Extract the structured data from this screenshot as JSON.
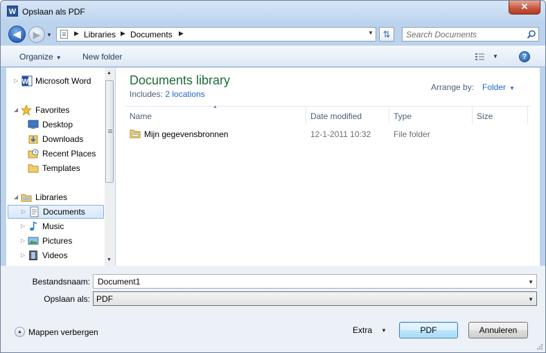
{
  "window": {
    "title": "Opslaan als PDF",
    "app_icon_letter": "W",
    "close_glyph": "✕"
  },
  "address_bar": {
    "breadcrumbs": [
      "Libraries",
      "Documents"
    ],
    "search_placeholder": "Search Documents"
  },
  "toolbar": {
    "organize_label": "Organize",
    "new_folder_label": "New folder",
    "help_glyph": "?"
  },
  "nav_pane": {
    "items": [
      {
        "label": "Microsoft Word",
        "icon": "word-icon",
        "indent": 0,
        "expander": "collapsed"
      },
      {
        "label": "Favorites",
        "icon": "star-icon",
        "indent": 0,
        "expander": "expanded"
      },
      {
        "label": "Desktop",
        "icon": "desktop-icon",
        "indent": 1,
        "expander": "none"
      },
      {
        "label": "Downloads",
        "icon": "downloads-icon",
        "indent": 1,
        "expander": "none"
      },
      {
        "label": "Recent Places",
        "icon": "recent-places-icon",
        "indent": 1,
        "expander": "none"
      },
      {
        "label": "Templates",
        "icon": "folder-icon",
        "indent": 1,
        "expander": "none"
      },
      {
        "label": "Libraries",
        "icon": "libraries-icon",
        "indent": 0,
        "expander": "expanded"
      },
      {
        "label": "Documents",
        "icon": "documents-icon",
        "indent": 1,
        "expander": "collapsed",
        "selected": true
      },
      {
        "label": "Music",
        "icon": "music-icon",
        "indent": 1,
        "expander": "collapsed"
      },
      {
        "label": "Pictures",
        "icon": "pictures-icon",
        "indent": 1,
        "expander": "collapsed"
      },
      {
        "label": "Videos",
        "icon": "videos-icon",
        "indent": 1,
        "expander": "collapsed"
      }
    ]
  },
  "file_pane": {
    "library_title": "Documents library",
    "includes_label": "Includes:",
    "includes_link": "2 locations",
    "arrange_by_label": "Arrange by:",
    "arrange_by_value": "Folder",
    "columns": [
      "Name",
      "Date modified",
      "Type",
      "Size"
    ],
    "rows": [
      {
        "name": "Mijn gegevensbronnen",
        "date_modified": "12-1-2011 10:32",
        "type": "File folder",
        "size": ""
      }
    ]
  },
  "save_form": {
    "filename_label": "Bestandsnaam:",
    "filename_value": "Document1",
    "savetype_label": "Opslaan als:",
    "savetype_value": "PDF"
  },
  "footer": {
    "hide_folders_label": "Mappen verbergen",
    "extra_label": "Extra",
    "save_button_label": "PDF",
    "cancel_button_label": "Annuleren"
  },
  "colors": {
    "library_title": "#1e6a3a",
    "link": "#2066c8",
    "frame": "#bcd3ee"
  }
}
